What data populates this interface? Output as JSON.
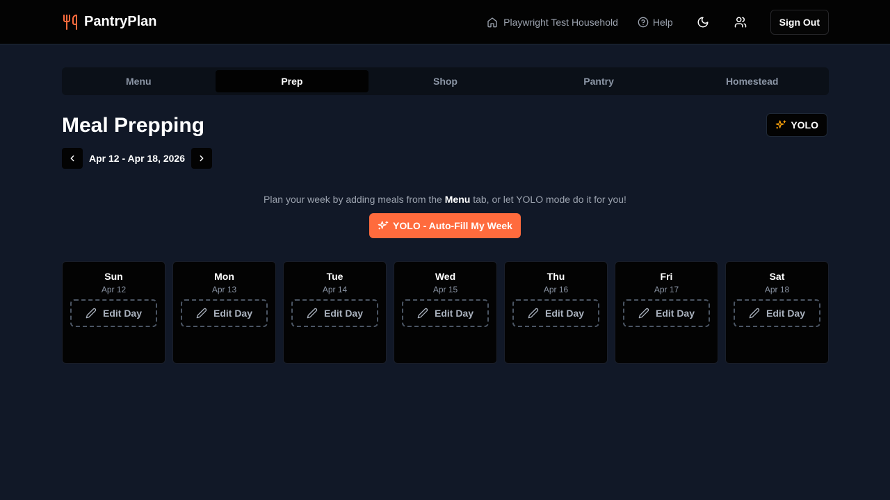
{
  "app": {
    "name": "PantryPlan"
  },
  "header": {
    "household": "Playwright Test Household",
    "help": "Help",
    "sign_out": "Sign Out"
  },
  "tabs": [
    {
      "label": "Menu",
      "active": false
    },
    {
      "label": "Prep",
      "active": true
    },
    {
      "label": "Shop",
      "active": false
    },
    {
      "label": "Pantry",
      "active": false
    },
    {
      "label": "Homestead",
      "active": false
    }
  ],
  "page": {
    "title": "Meal Prepping",
    "yolo_label": "YOLO",
    "week_range": "Apr 12 - Apr 18, 2026",
    "hint_before": "Plan your week by adding meals from the ",
    "hint_strong": "Menu",
    "hint_after": " tab, or let YOLO mode do it for you!",
    "autofill_label": "YOLO - Auto-Fill My Week"
  },
  "days": [
    {
      "name": "Sun",
      "date": "Apr 12",
      "action": "Edit Day"
    },
    {
      "name": "Mon",
      "date": "Apr 13",
      "action": "Edit Day"
    },
    {
      "name": "Tue",
      "date": "Apr 14",
      "action": "Edit Day"
    },
    {
      "name": "Wed",
      "date": "Apr 15",
      "action": "Edit Day"
    },
    {
      "name": "Thu",
      "date": "Apr 16",
      "action": "Edit Day"
    },
    {
      "name": "Fri",
      "date": "Apr 17",
      "action": "Edit Day"
    },
    {
      "name": "Sat",
      "date": "Apr 18",
      "action": "Edit Day"
    }
  ],
  "colors": {
    "accent": "#ff6b3d",
    "background": "#111827",
    "surface": "#030303"
  },
  "icons": {
    "brand": "utensils-icon",
    "household": "home-icon",
    "help": "help-circle-icon",
    "theme": "moon-icon",
    "profile": "users-icon",
    "yolo": "sparkles-icon",
    "prev": "chevron-left-icon",
    "next": "chevron-right-icon",
    "edit": "pencil-icon"
  }
}
